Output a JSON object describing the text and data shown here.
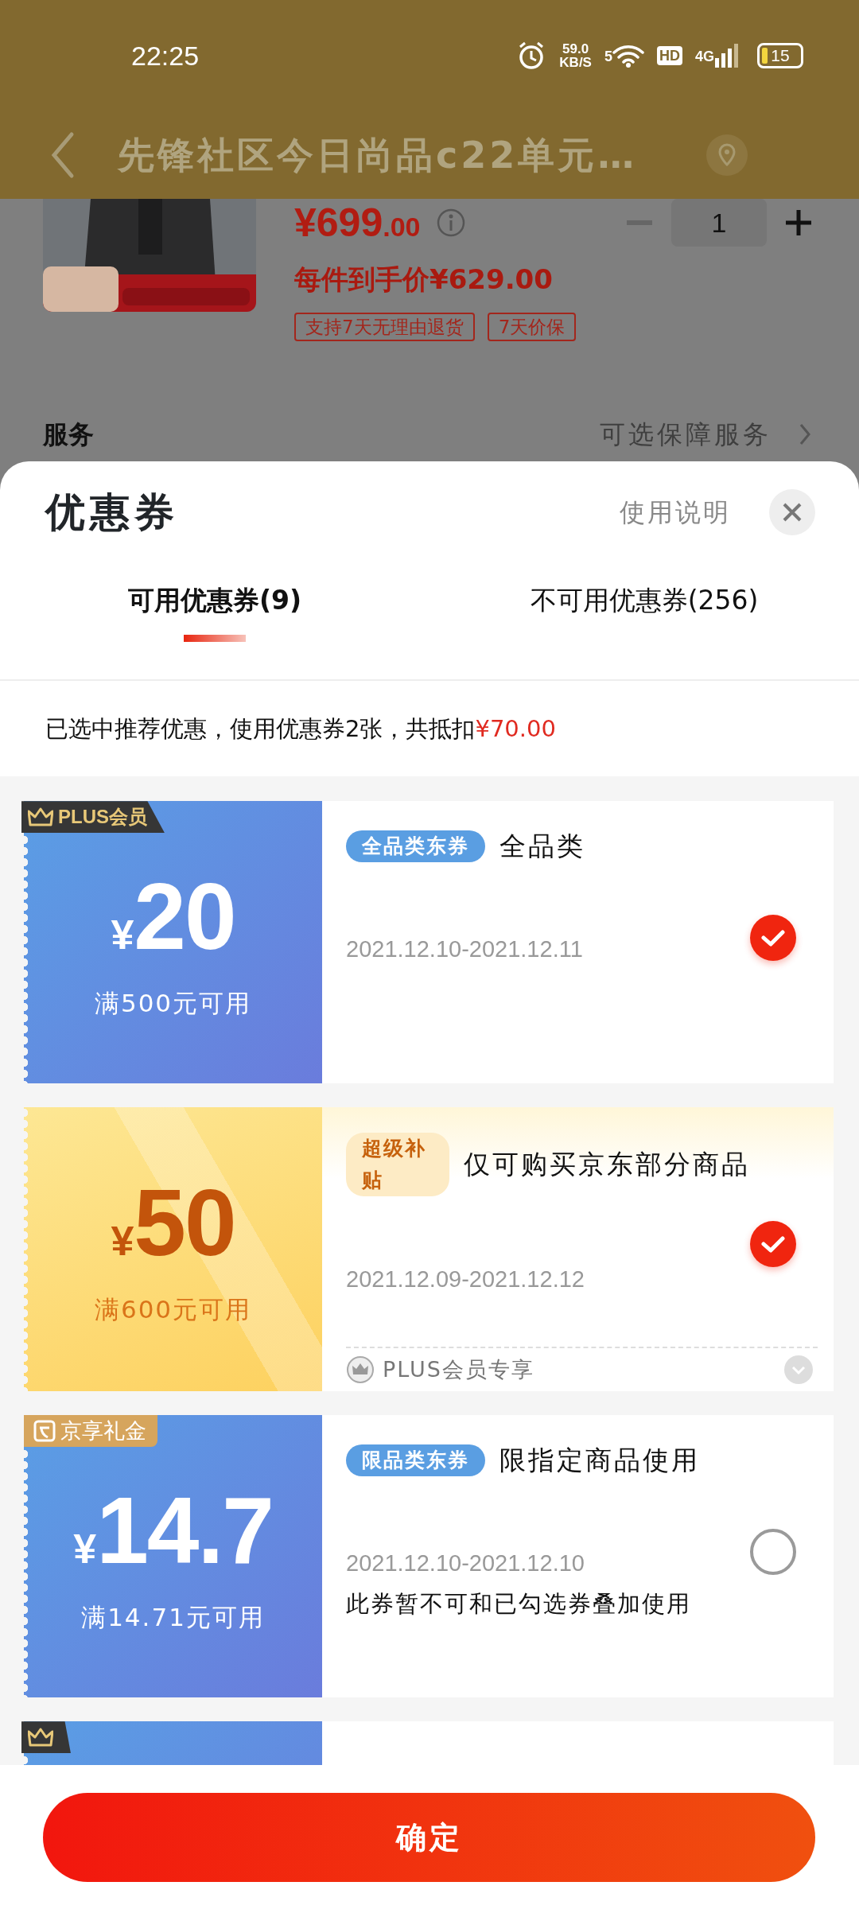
{
  "status_bar": {
    "time": "22:25",
    "net_speed": "59.0",
    "net_unit": "KB/S",
    "wifi_label": "5",
    "hd": "HD",
    "network": "4G",
    "battery": "15"
  },
  "header": {
    "title": "先锋社区今日尚品c22单元…"
  },
  "product": {
    "price": "¥699",
    "price_decimals": ".00",
    "quantity": "1",
    "final_price": "每件到手价¥629.00",
    "tags": [
      "支持7天无理由退货",
      "7天价保"
    ]
  },
  "service": {
    "label": "服务",
    "value": "可选保障服务"
  },
  "sheet": {
    "title": "优惠券",
    "help_link": "使用说明",
    "tabs": [
      {
        "label": "可用优惠券(9)",
        "selected": true
      },
      {
        "label": "不可用优惠券(256)",
        "selected": false
      }
    ],
    "summary": {
      "text": "已选中推荐优惠，使用优惠券2张，共抵扣",
      "amount": "¥70.00"
    }
  },
  "coupons": [
    {
      "kind": "regular",
      "badge": {
        "kind": "plus",
        "label": "PLUS会员"
      },
      "currency": "¥",
      "amount": "20",
      "condition": "满500元可用",
      "tag": "全品类东券",
      "title": "全品类",
      "dates": "2021.12.10-2021.12.11",
      "selected": true
    },
    {
      "kind": "subsidy",
      "currency": "¥",
      "amount": "50",
      "condition": "满600元可用",
      "tag": "超级补贴",
      "title": "仅可购买京东部分商品",
      "dates": "2021.12.09-2021.12.12",
      "footer": "PLUS会员专享",
      "selected": true
    },
    {
      "kind": "regular",
      "badge": {
        "kind": "gift",
        "label": "京享礼金"
      },
      "currency": "¥",
      "amount": "14.7",
      "condition": "满14.71元可用",
      "tag": "限品类东券",
      "title": "限指定商品使用",
      "dates": "2021.12.10-2021.12.10",
      "note": "此券暂不可和已勾选券叠加使用",
      "selected": false
    },
    {
      "kind": "regular",
      "badge": {
        "kind": "plus"
      }
    }
  ],
  "confirm_button": "确定"
}
